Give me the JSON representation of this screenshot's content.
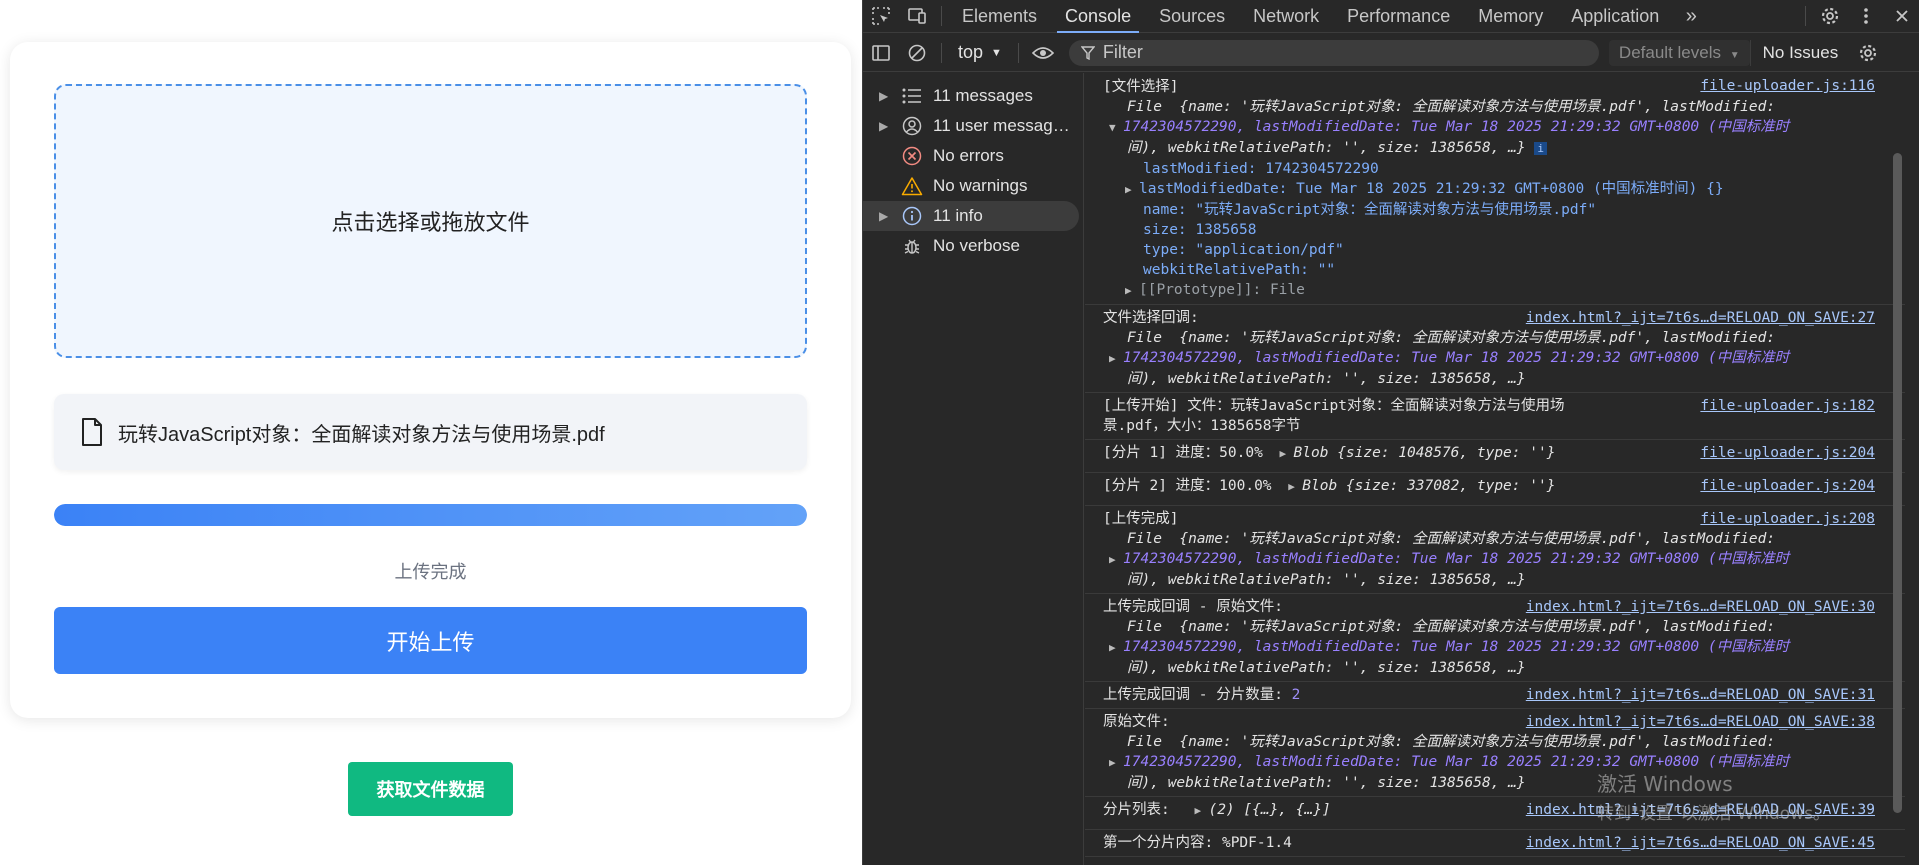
{
  "page": {
    "dropzone_text": "点击选择或拖放文件",
    "file_name": "玩转JavaScript对象：全面解读对象方法与使用场景.pdf",
    "progress": 100,
    "status_text": "上传完成",
    "upload_button": "开始上传",
    "fetch_button": "获取文件数据"
  },
  "devtools": {
    "tabs": [
      "Elements",
      "Console",
      "Sources",
      "Network",
      "Performance",
      "Memory",
      "Application"
    ],
    "active_tab": "Console",
    "context": "top",
    "filter_placeholder": "Filter",
    "levels": "Default levels",
    "issues": "No Issues",
    "sidebar": [
      {
        "label": "11 messages",
        "icon": "list-icon"
      },
      {
        "label": "11 user messag…",
        "icon": "user-icon"
      },
      {
        "label": "No errors",
        "icon": "error-icon"
      },
      {
        "label": "No warnings",
        "icon": "warning-icon"
      },
      {
        "label": "11 info",
        "icon": "info-icon"
      },
      {
        "label": "No verbose",
        "icon": "bug-icon"
      }
    ],
    "messages": {
      "m1_head": "[文件选择]",
      "m1_src": "file-uploader.js:116",
      "m2_head": "文件选择回调:",
      "m2_src": "index.html?_ijt=7t6s…d=RELOAD_ON_SAVE:27",
      "m3_head": "[上传开始] 文件：玩转JavaScript对象：全面解读对象方法与使用场",
      "m3_head2": "景.pdf，大小：1385658字节",
      "m3_src": "file-uploader.js:182",
      "m4_head": "[分片 1] 进度：50.0%",
      "m4_src": "file-uploader.js:204",
      "m5_head": "[分片 2] 进度：100.0%",
      "m5_src": "file-uploader.js:204",
      "m6_head": "[上传完成]",
      "m6_src": "file-uploader.js:208",
      "m7_head": "上传完成回调 - 原始文件:",
      "m7_src": "index.html?_ijt=7t6s…d=RELOAD_ON_SAVE:30",
      "m8_head": "上传完成回调 - 分片数量:",
      "m8_val": "2",
      "m8_src": "index.html?_ijt=7t6s…d=RELOAD_ON_SAVE:31",
      "m9_head": "原始文件:",
      "m9_src": "index.html?_ijt=7t6s…d=RELOAD_ON_SAVE:38",
      "m10_head": "分片列表:",
      "m10_src": "index.html?_ijt=7t6s…d=RELOAD_ON_SAVE:39",
      "m11_head": "第一个分片内容: %PDF-1.4",
      "m11_src": "index.html?_ijt=7t6s…d=RELOAD_ON_SAVE:45"
    },
    "file_obj": {
      "summary_a": "File  {name: '玩转JavaScript对象: 全面解读对象方法与使用场景.pdf', lastModified:",
      "summary_b": "1742304572290, lastModifiedDate: Tue Mar 18 2025 21:29:32 GMT+0800 (中国标准时",
      "summary_c": "间), webkitRelativePath: '', size: 1385658, …}",
      "lastModified": "lastModified: 1742304572290",
      "lastModifiedDate": "lastModifiedDate: Tue Mar 18 2025 21:29:32 GMT+0800 (中国标准时间) {}",
      "name": "name: \"玩转JavaScript对象：全面解读对象方法与使用场景.pdf\"",
      "size": "size: 1385658",
      "type": "type: \"application/pdf\"",
      "webkitRelativePath": "webkitRelativePath: \"\"",
      "prototype": "[[Prototype]]: File"
    },
    "blobs": {
      "b1": "Blob {size: 1048576, type: ''}",
      "b2": "Blob {size: 337082, type: ''}"
    },
    "list": "(2) [{…}, {…}]"
  },
  "watermark": {
    "line1": "激活 Windows",
    "line2": "转到\"设置\"以激活 Windows。"
  }
}
